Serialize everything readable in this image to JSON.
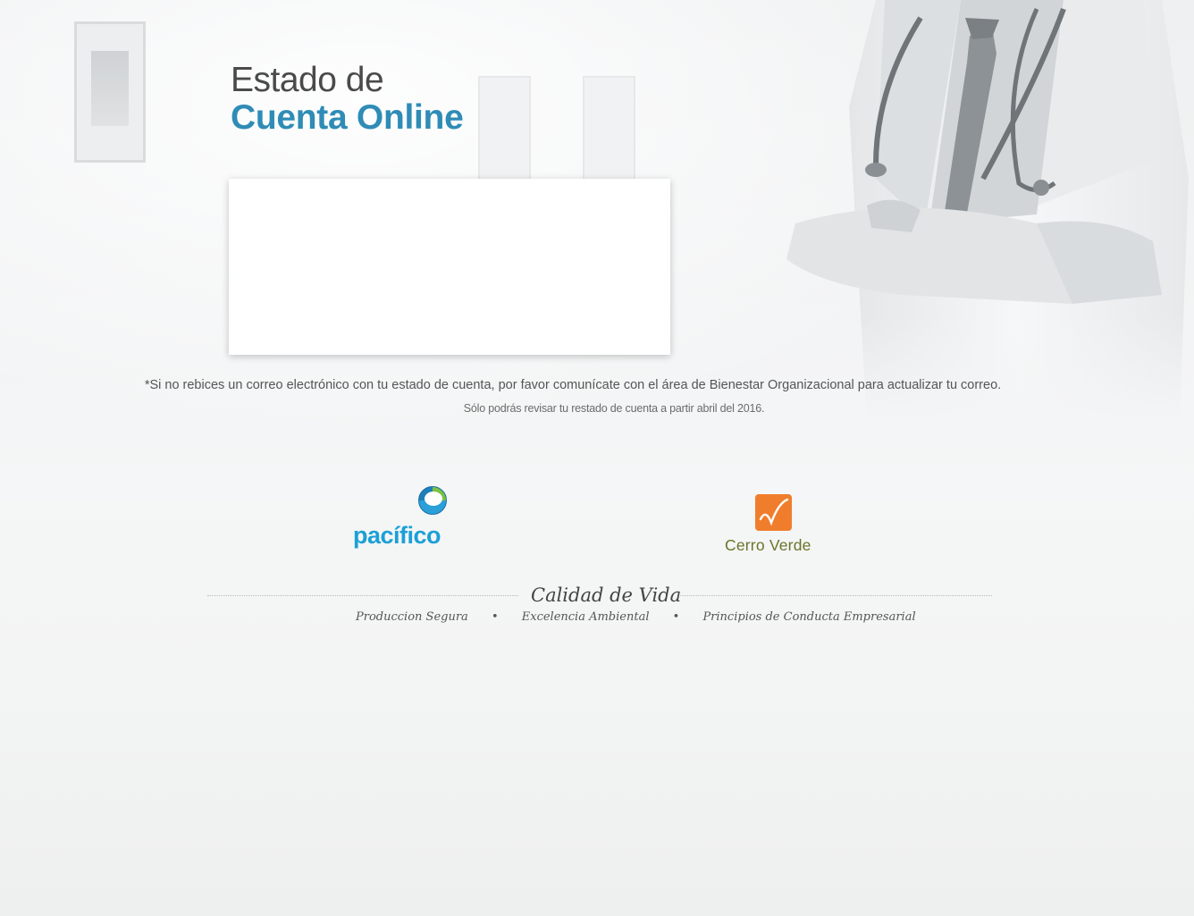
{
  "header": {
    "title_line1": "Estado de",
    "title_line2": "Cuenta Online"
  },
  "notice": {
    "main": "*Si no rebices un correo electrónico con tu estado de cuenta, por favor comunícate con el área de Bienestar Organizacional para actualizar tu correo.",
    "sub": "Sólo podrás revisar tu restado de cuenta a partir abril del 2016."
  },
  "logos": {
    "pacifico": "pacífico",
    "cerro_verde": "Cerro Verde"
  },
  "footer": {
    "tagline": "Calidad de Vida",
    "pillars": [
      "Produccion Segura",
      "Excelencia Ambiental",
      "Principios de Conducta Empresarial"
    ]
  },
  "colors": {
    "title_blue": "#2f8cb6",
    "pacifico_blue": "#1ba0d6",
    "cerro_verde_orange": "#f07d2c",
    "cerro_verde_text": "#6b7328"
  }
}
